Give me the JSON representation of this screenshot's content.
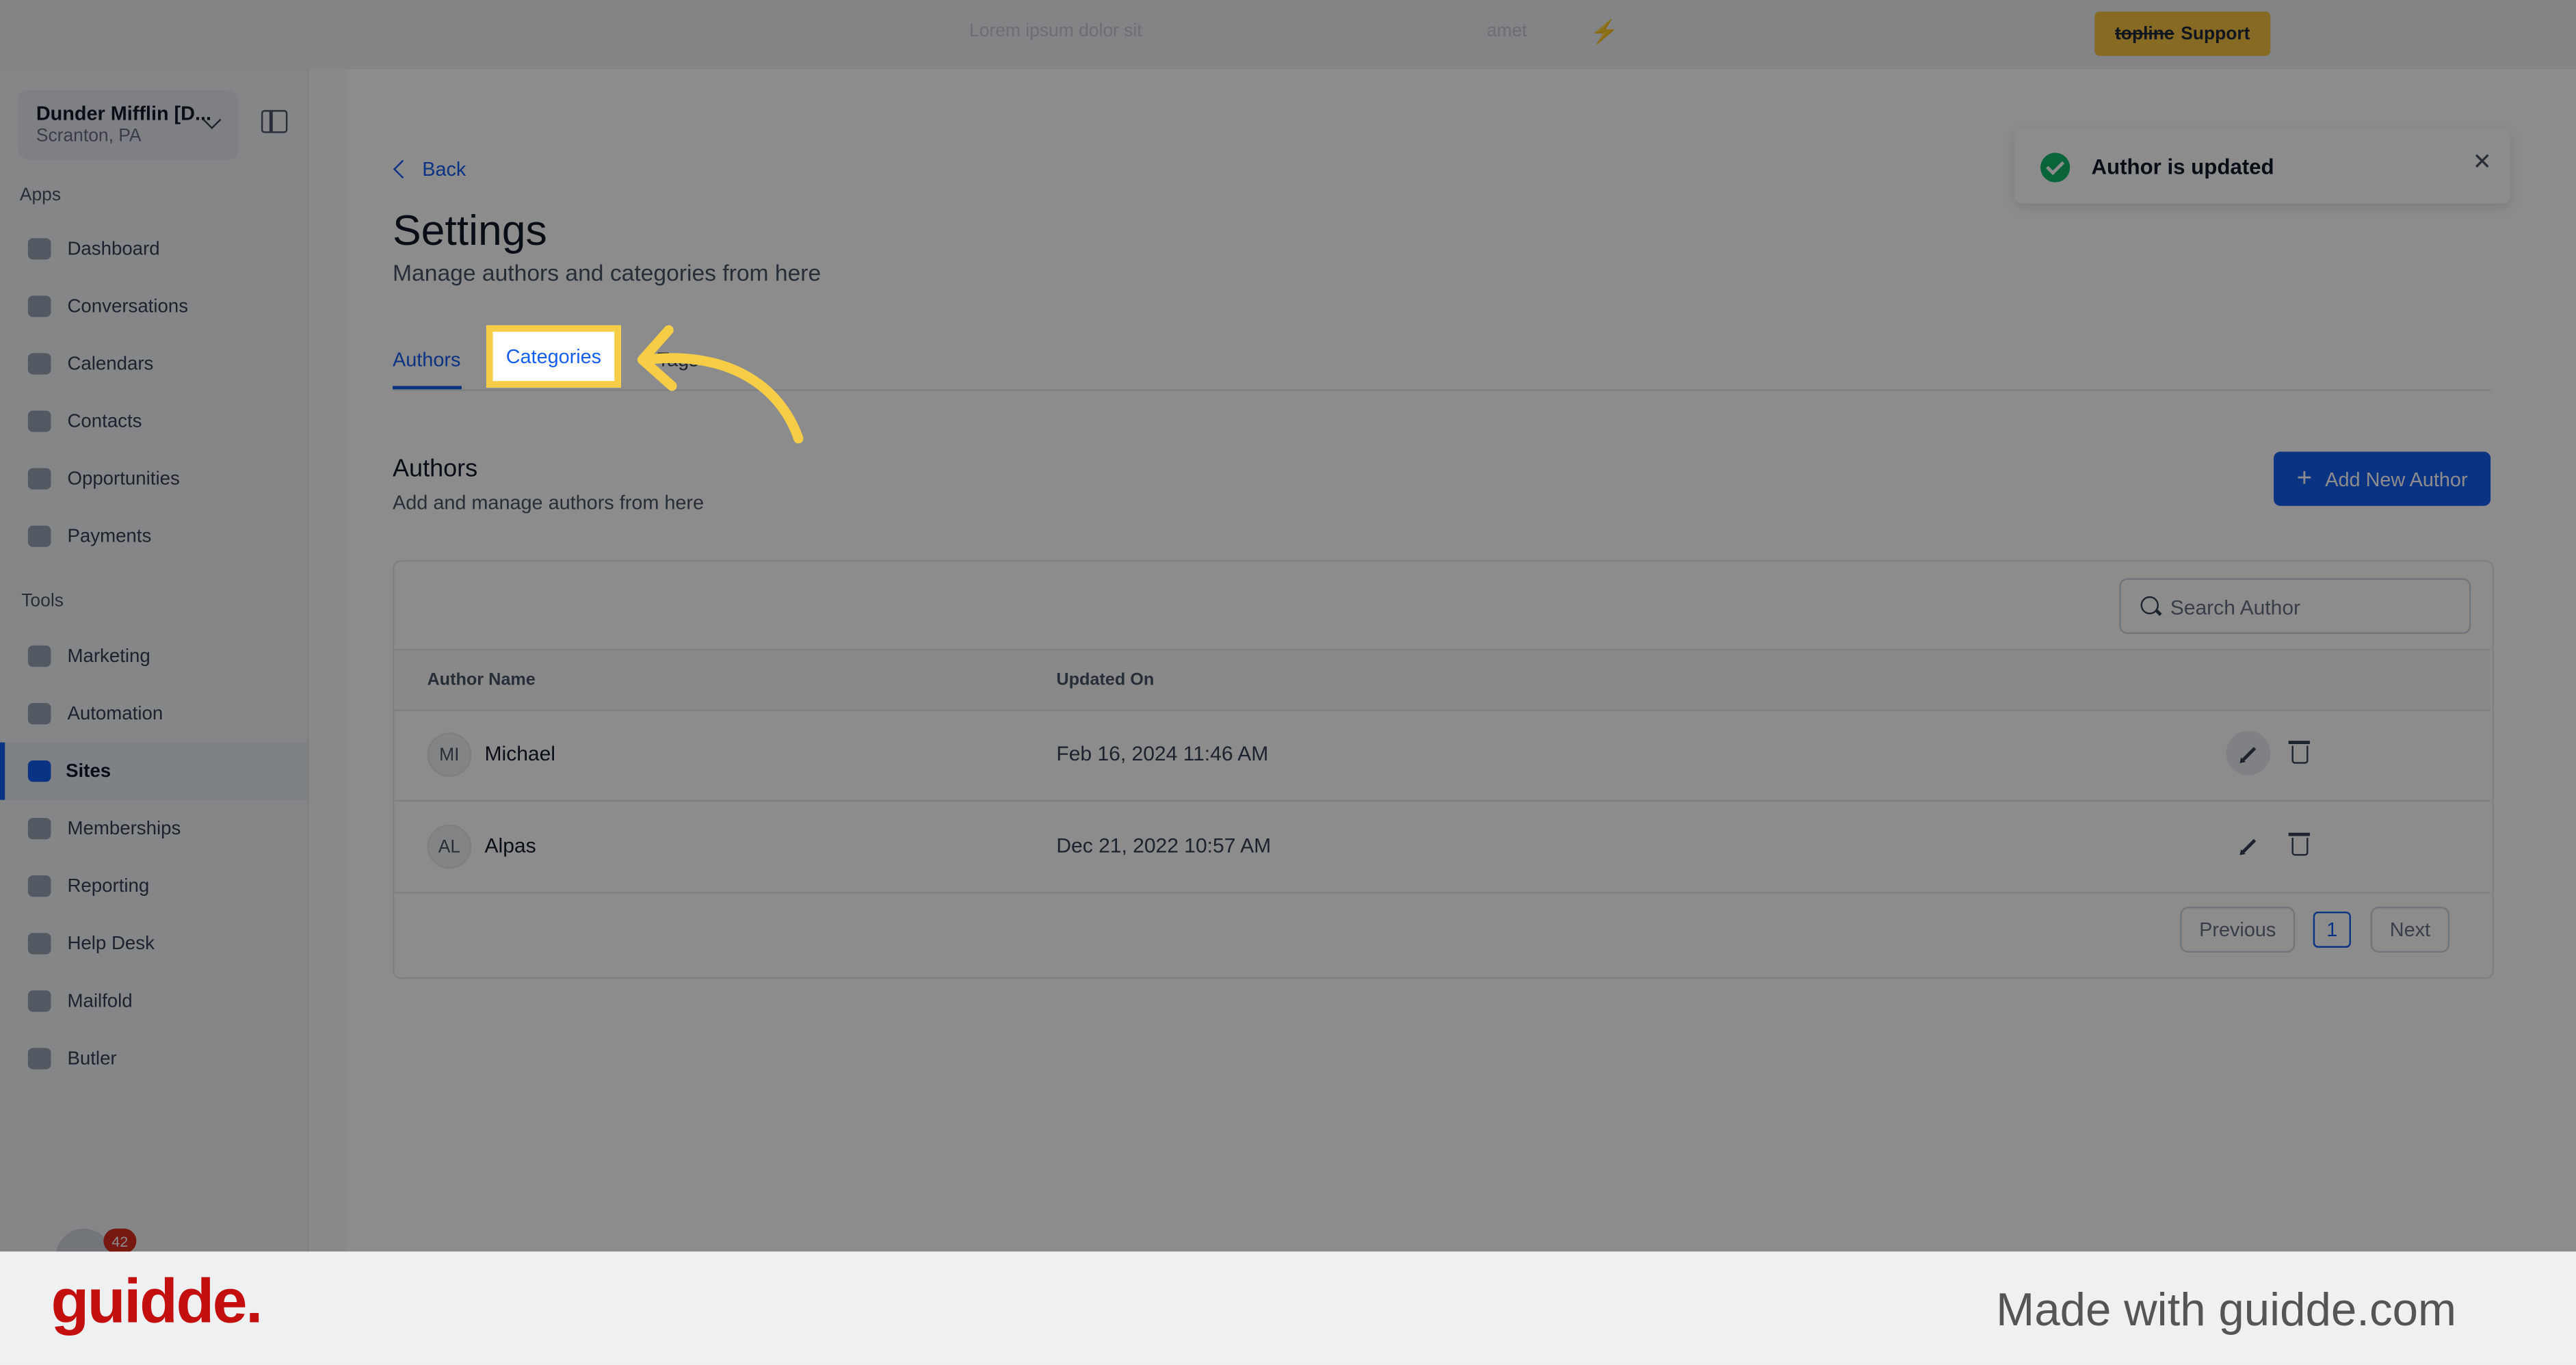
{
  "topbar": {
    "faded_1": "Lorem ipsum dolor sit",
    "faded_2": "amet",
    "support_brand": "topline",
    "support_label": "Support",
    "bolt_icon": "lightning-icon"
  },
  "sidebar": {
    "location_name": "Dunder Mifflin [D...",
    "location_city": "Scranton, PA",
    "apps_label": "Apps",
    "tools_label": "Tools",
    "apps": [
      {
        "label": "Dashboard",
        "icon": "dashboard-icon"
      },
      {
        "label": "Conversations",
        "icon": "chat-icon"
      },
      {
        "label": "Calendars",
        "icon": "calendar-icon"
      },
      {
        "label": "Contacts",
        "icon": "user-icon"
      },
      {
        "label": "Opportunities",
        "icon": "target-icon"
      },
      {
        "label": "Payments",
        "icon": "card-icon"
      }
    ],
    "tools": [
      {
        "label": "Marketing",
        "icon": "megaphone-icon"
      },
      {
        "label": "Automation",
        "icon": "gears-icon"
      },
      {
        "label": "Sites",
        "icon": "globe-icon",
        "active": true
      },
      {
        "label": "Memberships",
        "icon": "users-icon"
      },
      {
        "label": "Reporting",
        "icon": "pie-chart-icon"
      },
      {
        "label": "Help Desk",
        "icon": "help-icon"
      },
      {
        "label": "Mailfold",
        "icon": "mail-icon"
      },
      {
        "label": "Butler",
        "icon": "butler-icon"
      }
    ],
    "notification_count": "42"
  },
  "main": {
    "back_label": "Back",
    "title": "Settings",
    "subtitle": "Manage authors and categories from here",
    "tabs": [
      {
        "label": "Authors",
        "active": true
      },
      {
        "label": "Categories",
        "highlighted": true
      },
      {
        "label": "Tags"
      }
    ],
    "section_title": "Authors",
    "section_subtitle": "Add and manage authors from here",
    "add_button": "Add New Author",
    "search_placeholder": "Search Author",
    "columns": [
      "Author Name",
      "Updated On"
    ],
    "rows": [
      {
        "initials": "MI",
        "name": "Michael",
        "updated": "Feb 16, 2024 11:46 AM"
      },
      {
        "initials": "AL",
        "name": "Alpas",
        "updated": "Dec 21, 2022 10:57 AM"
      }
    ],
    "pagination": {
      "previous": "Previous",
      "page": "1",
      "next": "Next"
    }
  },
  "toast": {
    "message": "Author is updated"
  },
  "footer": {
    "logo": "guidde.",
    "made_with": "Made with guidde.com"
  },
  "colors": {
    "accent": "#155eef",
    "highlight": "#f5cd47",
    "success": "#12b76a",
    "brand_red": "#c40f0f"
  }
}
